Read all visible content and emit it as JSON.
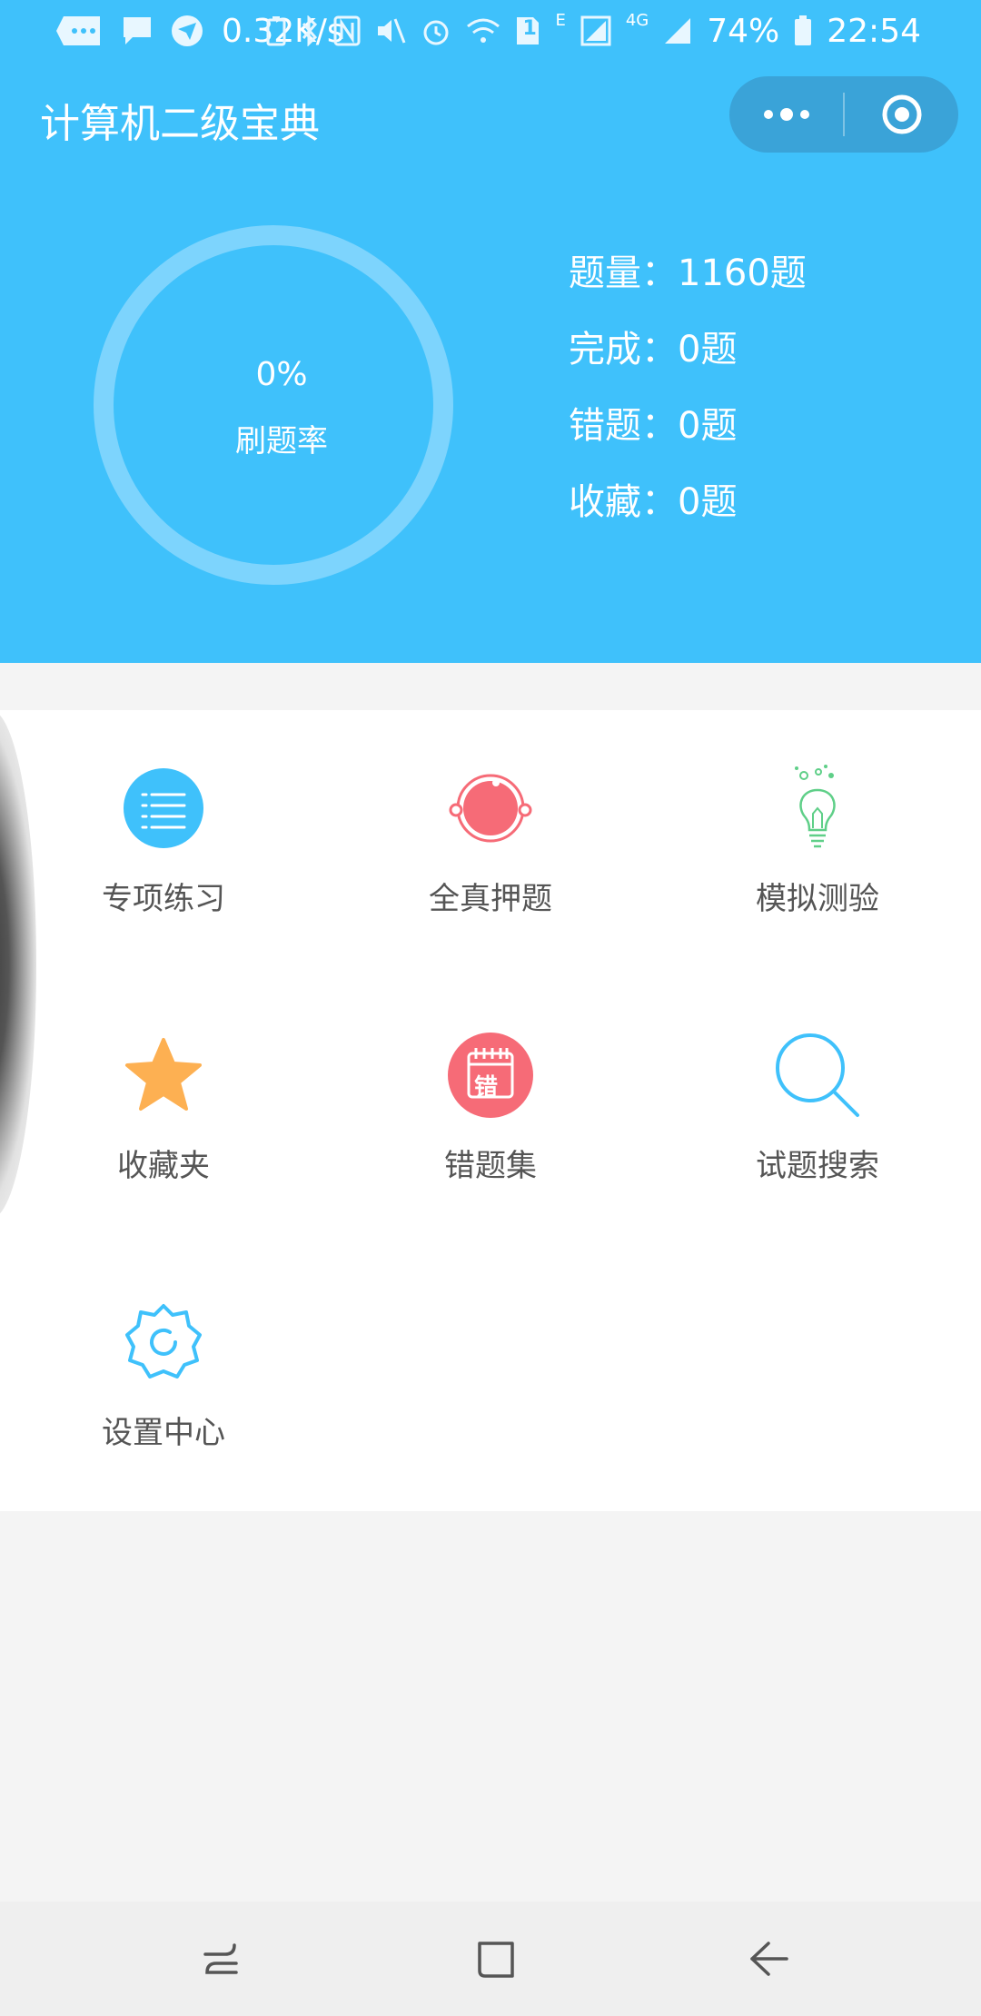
{
  "status_bar": {
    "speed": "0.32K/s",
    "sim_badge": "1",
    "network_e": "E",
    "network_4g": "4G",
    "battery": "74%",
    "time": "22:54"
  },
  "header": {
    "title": "计算机二级宝典",
    "capsule_more_icon": "more-dots-icon",
    "capsule_close_icon": "target-icon"
  },
  "progress": {
    "rate_value": "0%",
    "rate_label": "刷题率",
    "rate_fraction": 0
  },
  "stats": [
    {
      "label": "题量",
      "sep": "：",
      "value": "1160题"
    },
    {
      "label": "完成",
      "sep": "：",
      "value": "0题"
    },
    {
      "label": "错题",
      "sep": "：",
      "value": "0题"
    },
    {
      "label": "收藏",
      "sep": "：",
      "value": "0题"
    }
  ],
  "menu": [
    {
      "label": "专项练习",
      "icon": "list-icon",
      "color": "#3fc1fb"
    },
    {
      "label": "全真押题",
      "icon": "orbit-icon",
      "color": "#f66b77"
    },
    {
      "label": "模拟测验",
      "icon": "lightbulb-icon",
      "color": "#5fcf88"
    },
    {
      "label": "收藏夹",
      "icon": "star-icon",
      "color": "#fdb052"
    },
    {
      "label": "错题集",
      "icon": "calendar-mistake-icon",
      "color": "#f66b77",
      "badge": "错"
    },
    {
      "label": "试题搜索",
      "icon": "search-icon",
      "color": "#3fc1fb"
    },
    {
      "label": "设置中心",
      "icon": "gear-icon",
      "color": "#3fc1fb"
    }
  ],
  "colors": {
    "header_bg": "#3fc1fb",
    "ring": "#7dd4fd",
    "panel_bg": "#ffffff",
    "page_bg": "#f4f4f4"
  }
}
